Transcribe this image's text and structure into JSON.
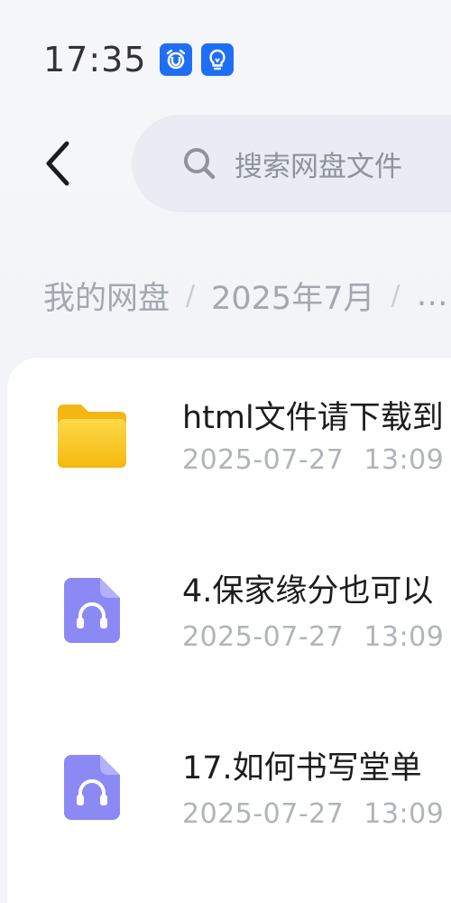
{
  "status_bar": {
    "time": "17:35",
    "icons": [
      "alarm-app-icon",
      "lightbulb-app-icon"
    ]
  },
  "header": {
    "back_icon": "chevron-left-icon",
    "search": {
      "icon": "search-icon",
      "placeholder": "搜索网盘文件"
    }
  },
  "breadcrumb": {
    "items": [
      "我的网盘",
      "2025年7月",
      "…"
    ],
    "separator": "/"
  },
  "files": [
    {
      "icon": "folder-icon",
      "name": "html文件请下载到",
      "date": "2025-07-27",
      "time": "13:09"
    },
    {
      "icon": "audio-file-icon",
      "name": "4.保家缘分也可以",
      "date": "2025-07-27",
      "time": "13:09"
    },
    {
      "icon": "audio-file-icon",
      "name": "17.如何书写堂单",
      "date": "2025-07-27",
      "time": "13:09"
    }
  ],
  "colors": {
    "accent_blue": "#1f6ef6",
    "folder_yellow": "#f9c41a",
    "audio_purple": "#8c89f5",
    "text_primary": "#1c1c1e",
    "text_secondary": "#b0b4bb"
  }
}
